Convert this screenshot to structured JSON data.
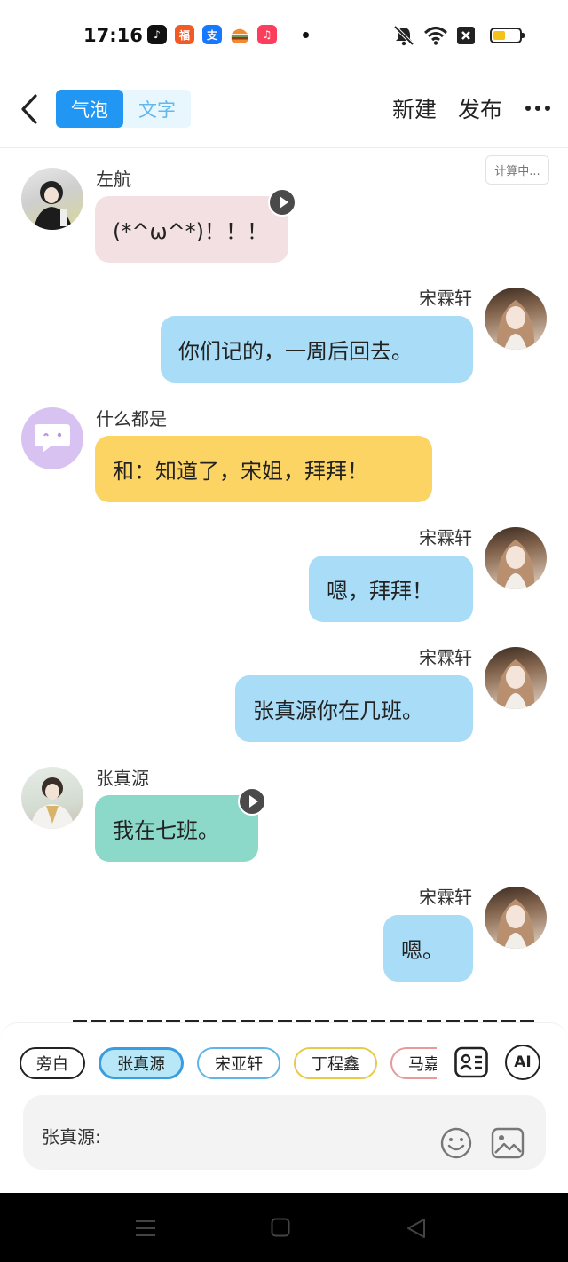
{
  "status_bar": {
    "time": "17:16",
    "apps": [
      {
        "icon": "douyin-icon",
        "label": "♪",
        "color": "#111111"
      },
      {
        "icon": "taobao-deals-icon",
        "label": "福",
        "color": "#f15a24"
      },
      {
        "icon": "alipay-icon",
        "label": "支",
        "color": "#1677ff"
      },
      {
        "icon": "burger-icon",
        "label": "",
        "color": "#f26b22"
      },
      {
        "icon": "music-icon",
        "label": "♫",
        "color": "#fc3d5c"
      }
    ],
    "battery_level": 0.45
  },
  "nav": {
    "tab_bubble": "气泡",
    "tab_text": "文字",
    "new_label": "新建",
    "publish_label": "发布"
  },
  "calc_badge": "计算中...",
  "messages": [
    {
      "name": "左航",
      "text": "(*^ω^*)！！！",
      "side": "left",
      "bubble_color": "#f3e0e2",
      "has_voice": true
    },
    {
      "name": "宋霖轩",
      "text": "你们记的，一周后回去。",
      "side": "right",
      "bubble_color": "#a8dcf7",
      "has_voice": false
    },
    {
      "name": "什么都是",
      "text": "和：知道了，宋姐，拜拜！",
      "side": "left",
      "bubble_color": "#fcd463",
      "has_voice": false
    },
    {
      "name": "宋霖轩",
      "text": "嗯，拜拜！",
      "side": "right",
      "bubble_color": "#a8dcf7",
      "has_voice": false
    },
    {
      "name": "宋霖轩",
      "text": "张真源你在几班。",
      "side": "right",
      "bubble_color": "#a8dcf7",
      "has_voice": false
    },
    {
      "name": "张真源",
      "text": "我在七班。",
      "side": "left",
      "bubble_color": "#8cd9c9",
      "has_voice": true
    },
    {
      "name": "宋霖轩",
      "text": "嗯。",
      "side": "right",
      "bubble_color": "#a8dcf7",
      "has_voice": false
    }
  ],
  "roles": [
    {
      "label": "旁白",
      "border": "#222222",
      "bg": "#ffffff",
      "selected": false
    },
    {
      "label": "张真源",
      "border": "#3a9de0",
      "bg": "#b8e7f7",
      "selected": true
    },
    {
      "label": "宋亚轩",
      "border": "#5fb4e8",
      "bg": "#ffffff",
      "selected": false
    },
    {
      "label": "丁程鑫",
      "border": "#e8c94a",
      "bg": "#ffffff",
      "selected": false
    },
    {
      "label": "马嘉",
      "border": "#e89a9a",
      "bg": "#ffffff",
      "selected": false
    }
  ],
  "tools": {
    "ai_label": "AI"
  },
  "input": {
    "speaker_label": "张真源:"
  }
}
